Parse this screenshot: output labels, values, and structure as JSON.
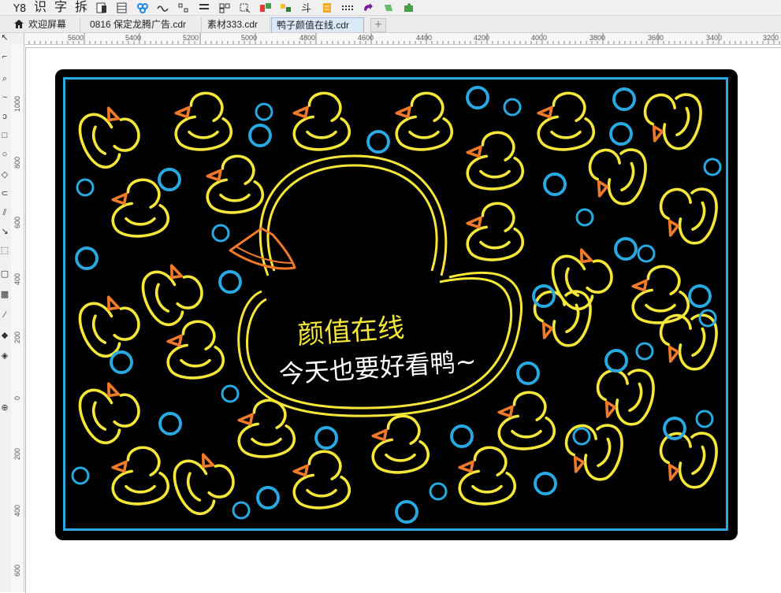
{
  "toolbar": {
    "buttons": [
      {
        "name": "toolbar-text-1",
        "label": "识"
      },
      {
        "name": "toolbar-text-2",
        "label": "字"
      },
      {
        "name": "toolbar-text-3",
        "label": "拆"
      }
    ]
  },
  "tabs": [
    {
      "label": "欢迎屏幕",
      "icon": "home-icon",
      "active": false
    },
    {
      "label": "0816 保定龙腾广告.cdr",
      "active": false
    },
    {
      "label": "素材333.cdr",
      "active": false
    },
    {
      "label": "鸭子颜值在线.cdr",
      "active": true
    }
  ],
  "tab_add_label": "+",
  "ruler": {
    "horizontal": [
      "5600",
      "5400",
      "5200",
      "5000",
      "4800",
      "4600",
      "4400",
      "4200",
      "4000",
      "3800",
      "3600",
      "3400",
      "3200"
    ],
    "vertical": [
      "1000",
      "800",
      "600",
      "400",
      "200",
      "0",
      "200",
      "400",
      "600"
    ]
  },
  "design": {
    "headline": "颜值在线",
    "subline": "今天也要好看鸭~",
    "colors": {
      "background": "#000000",
      "border": "#29a9e1",
      "neon_yellow": "#f5e63a",
      "neon_orange": "#f07a2a",
      "bubble": "#29a9e1",
      "text_white": "#ffffff"
    }
  }
}
